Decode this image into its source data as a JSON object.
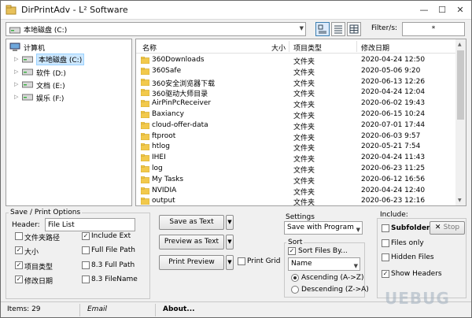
{
  "window": {
    "title": "DirPrintAdv - L² Software",
    "minimize": "—",
    "maximize": "☐",
    "close": "✕"
  },
  "toolbar": {
    "drive": "本地磁盘 (C:)",
    "filter_label": "Filter/s:",
    "filter_value": "*"
  },
  "tree": {
    "root": "计算机",
    "drives": [
      {
        "label": "本地磁盘 (C:)"
      },
      {
        "label": "软件 (D:)"
      },
      {
        "label": "文档 (E:)"
      },
      {
        "label": "娱乐 (F:)"
      }
    ]
  },
  "list": {
    "headers": {
      "name": "名称",
      "size": "大小",
      "type": "项目类型",
      "modified": "修改日期"
    },
    "rows": [
      {
        "name": "360Downloads",
        "type": "文件夹",
        "date": "2020-04-24 12:50"
      },
      {
        "name": "360Safe",
        "type": "文件夹",
        "date": "2020-05-06 9:20"
      },
      {
        "name": "360安全浏览器下载",
        "type": "文件夹",
        "date": "2020-06-13 12:26"
      },
      {
        "name": "360驱动大师目录",
        "type": "文件夹",
        "date": "2020-04-24 12:04"
      },
      {
        "name": "AirPinPcReceiver",
        "type": "文件夹",
        "date": "2020-06-02 19:43"
      },
      {
        "name": "Baxiancy",
        "type": "文件夹",
        "date": "2020-06-15 10:24"
      },
      {
        "name": "cloud-offer-data",
        "type": "文件夹",
        "date": "2020-07-01 17:44"
      },
      {
        "name": "ftproot",
        "type": "文件夹",
        "date": "2020-06-03 9:57"
      },
      {
        "name": "htlog",
        "type": "文件夹",
        "date": "2020-05-21 7:54"
      },
      {
        "name": "IHEI",
        "type": "文件夹",
        "date": "2020-04-24 11:43"
      },
      {
        "name": "log",
        "type": "文件夹",
        "date": "2020-06-23 11:25"
      },
      {
        "name": "My Tasks",
        "type": "文件夹",
        "date": "2020-06-12 16:56"
      },
      {
        "name": "NVIDIA",
        "type": "文件夹",
        "date": "2020-04-24 12:40"
      },
      {
        "name": "output",
        "type": "文件夹",
        "date": "2020-06-23 12:16"
      }
    ]
  },
  "save_print": {
    "group_label": "Save / Print Options",
    "header_label": "Header:",
    "header_value": "File List",
    "options": [
      {
        "label": "文件夹路径",
        "checked": false
      },
      {
        "label": "大小",
        "checked": true
      },
      {
        "label": "项目类型",
        "checked": true
      },
      {
        "label": "修改日期",
        "checked": true
      },
      {
        "label": "Include Ext",
        "checked": true
      },
      {
        "label": "Full File Path",
        "checked": false
      },
      {
        "label": "8.3 Full Path",
        "checked": false
      },
      {
        "label": "8.3 FileName",
        "checked": false
      }
    ]
  },
  "actions": {
    "save_text": "Save as Text",
    "preview_text": "Preview as Text",
    "print_preview": "Print Preview",
    "print_grid": "Print Grid",
    "print_grid_checked": false
  },
  "settings": {
    "label": "Settings",
    "value": "Save with Program"
  },
  "sort": {
    "label": "Sort",
    "sort_files": "Sort Files By...",
    "sort_files_checked": true,
    "by": "Name",
    "ascending": "Ascending (A->Z)",
    "descending": "Descending (Z->A)",
    "selected": "ascending"
  },
  "include": {
    "label": "Include:",
    "subfolders": "Subfolders",
    "stop": "Stop",
    "files_only": "Files only",
    "hidden": "Hidden Files",
    "show_headers": "Show Headers",
    "subfolders_checked": false,
    "files_only_checked": false,
    "hidden_checked": false,
    "show_headers_checked": true
  },
  "status": {
    "items": "Items: 29",
    "email": "Email",
    "about": "About..."
  },
  "watermark": "UEBUG"
}
